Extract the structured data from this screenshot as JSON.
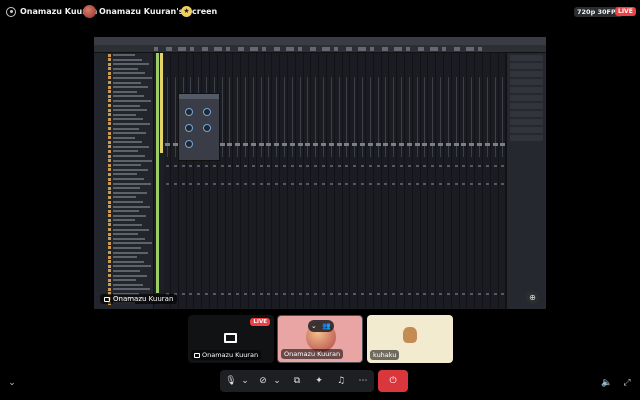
{
  "top_bar": {
    "user_name": "Onamazu Kuuran",
    "screen_title": "Onamazu Kuuran's Screen",
    "quality": "720p 30FPS",
    "live": "LIVE"
  },
  "stream": {
    "streamer_label": "Onamazu Kuuran",
    "zoom_icon": "zoom-in-icon"
  },
  "tiles": [
    {
      "name": "Onamazu Kuuran",
      "live": "LIVE",
      "type": "screen"
    },
    {
      "name": "Onamazu Kuuran",
      "type": "camera"
    },
    {
      "name": "kuhaku",
      "type": "avatar"
    }
  ],
  "controls": {
    "icons": [
      "microphone-icon",
      "camera-off-icon",
      "screen-share-icon",
      "activities-icon",
      "soundboard-icon",
      "more-icon",
      "leave-call-icon"
    ]
  },
  "colors": {
    "live_red": "#ed4245",
    "leave_red": "#da373c",
    "meter_green": "#9ccc65",
    "meter_yellow": "#e6d36a"
  }
}
